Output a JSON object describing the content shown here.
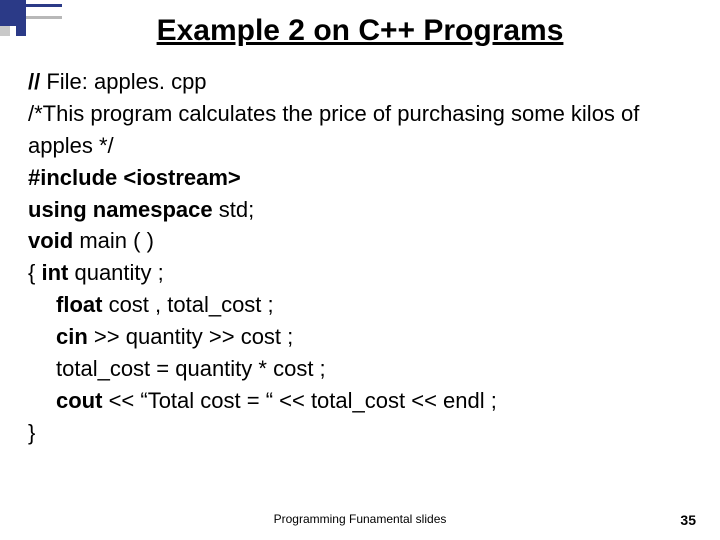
{
  "title": "Example 2 on C++ Programs",
  "code": {
    "l1a": "// ",
    "l1b": "File: apples. cpp",
    "l2": "/*This program calculates the price of purchasing some kilos of apples */",
    "l3a": "#include",
    "l3b": " <iostream>",
    "l4a": "using namespace",
    "l4b": " std;",
    "l5a": "void",
    "l5b": " main ( )",
    "l6a": "{   ",
    "l6b": "int  ",
    "l6c": " quantity ;",
    "l7a": "float  ",
    "l7b": " cost  , total_cost ;",
    "l8a": "cin",
    "l8b": " >>   quantity  >>  cost ;",
    "l9": "total_cost  =  quantity  *  cost ;",
    "l10a": "cout",
    "l10b": " <<    “Total cost = “ <<  total_cost << endl ;",
    "l11": "}"
  },
  "footer": {
    "center": "Programming Funamental slides",
    "page": "35"
  }
}
